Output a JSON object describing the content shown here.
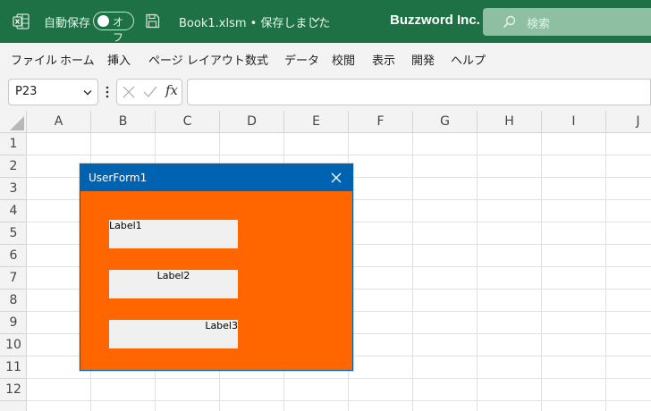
{
  "titlebar": {
    "autosave_label": "自動保存",
    "autosave_toggle": "オフ",
    "document_title": "Book1.xlsm • 保存しました",
    "company": "Buzzword Inc.",
    "search_placeholder": "検索",
    "accent_color": "#1e7145"
  },
  "menu": {
    "items": [
      "ファイル",
      "ホーム",
      "挿入",
      "ページ レイアウト",
      "数式",
      "データ",
      "校閲",
      "表示",
      "開発",
      "ヘルプ"
    ]
  },
  "formula_bar": {
    "name_box": "P23",
    "fx_label": "fx",
    "formula_value": ""
  },
  "grid": {
    "columns": [
      "A",
      "B",
      "C",
      "D",
      "E",
      "F",
      "G",
      "H",
      "I",
      "J"
    ],
    "rows": [
      "1",
      "2",
      "3",
      "4",
      "5",
      "6",
      "7",
      "8",
      "9",
      "10",
      "11",
      "12"
    ]
  },
  "userform": {
    "title": "UserForm1",
    "background_color": "#ff6600",
    "titlebar_color": "#0063b1",
    "labels": [
      {
        "caption": "Label1",
        "align": "left"
      },
      {
        "caption": "Label2",
        "align": "center"
      },
      {
        "caption": "Label3",
        "align": "right"
      }
    ]
  }
}
